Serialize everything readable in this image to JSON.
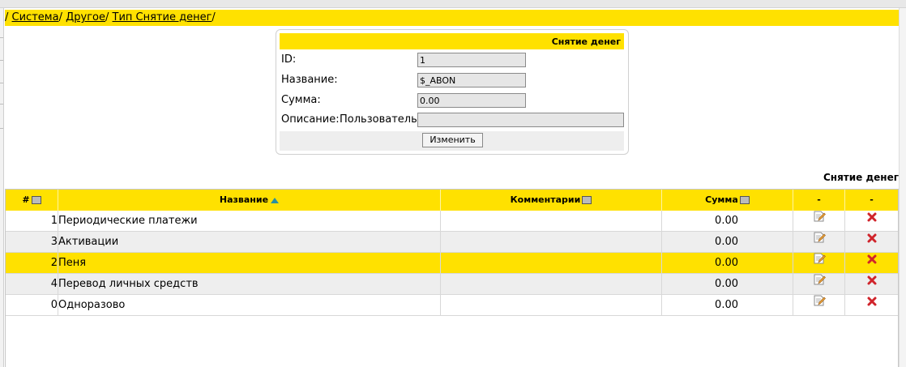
{
  "breadcrumb": {
    "separator": "/",
    "items": [
      "Система",
      "Другое",
      "Тип Снятие денег"
    ]
  },
  "form": {
    "title": "Снятие денег",
    "id_label": "ID:",
    "id_value": "1",
    "name_label": "Название:",
    "name_value": "$_ABON",
    "sum_label": "Сумма:",
    "sum_value": "0.00",
    "desc_label": "Описание:",
    "user_label": "Пользователь:",
    "user_value": "",
    "submit_label": "Изменить"
  },
  "table": {
    "title": "Снятие денег",
    "columns": {
      "num": "#",
      "name": "Название",
      "comment": "Комментарии",
      "sum": "Сумма",
      "edit": "-",
      "del": "-"
    },
    "rows": [
      {
        "num": "1",
        "name": "Периодические платежи",
        "comment": "",
        "sum": "0.00"
      },
      {
        "num": "3",
        "name": "Активации",
        "comment": "",
        "sum": "0.00"
      },
      {
        "num": "2",
        "name": "Пеня",
        "comment": "",
        "sum": "0.00"
      },
      {
        "num": "4",
        "name": "Перевод личных средств",
        "comment": "",
        "sum": "0.00"
      },
      {
        "num": "0",
        "name": "Одноразово",
        "comment": "",
        "sum": "0.00"
      }
    ],
    "selected_row": 2
  },
  "colors": {
    "accent": "#ffe100",
    "row_alt": "#eeeeee",
    "delete_icon": "#d0242b"
  },
  "icons": {
    "edit": "edit-icon",
    "delete": "delete-icon",
    "sort_asc": "sort-ascending-icon",
    "sort_toggle": "sort-toggle-icon"
  }
}
